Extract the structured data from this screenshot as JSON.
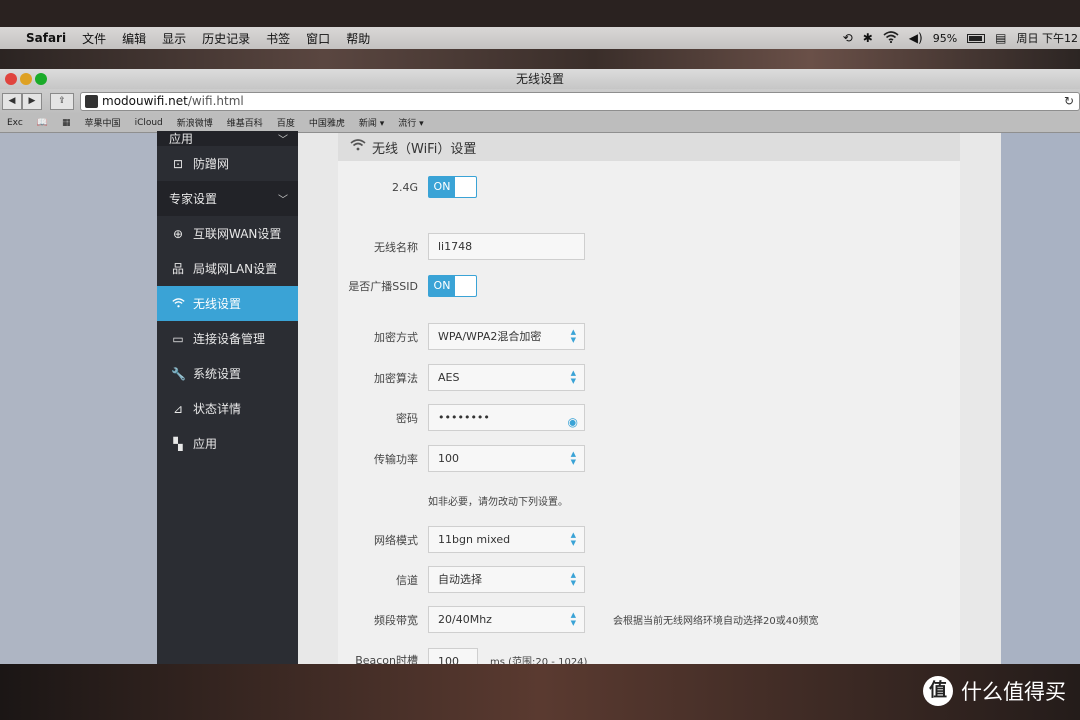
{
  "menubar": {
    "apple": "",
    "items": [
      "Safari",
      "文件",
      "编辑",
      "显示",
      "历史记录",
      "书签",
      "窗口",
      "帮助"
    ],
    "battery_percent": 95,
    "battery_label": "95%",
    "clock": "周日 下午12"
  },
  "browser": {
    "window_title": "无线设置",
    "url_domain": "modouwifi.net",
    "url_path": "/wifi.html",
    "bookmarks": [
      "Exc",
      "苹果中国",
      "iCloud",
      "新浪微博",
      "维基百科",
      "百度",
      "中国雅虎",
      "新闻 ▾",
      "流行 ▾"
    ]
  },
  "sidebar": {
    "items": [
      {
        "label": "应用",
        "icon": "apps-icon",
        "group": true
      },
      {
        "label": "防蹭网",
        "icon": "lock-icon"
      },
      {
        "label": "专家设置",
        "icon": "",
        "group": true
      },
      {
        "label": "互联网WAN设置",
        "icon": "globe-icon"
      },
      {
        "label": "局域网LAN设置",
        "icon": "network-icon"
      },
      {
        "label": "无线设置",
        "icon": "wifi-icon",
        "active": true
      },
      {
        "label": "连接设备管理",
        "icon": "monitor-icon"
      },
      {
        "label": "系统设置",
        "icon": "wrench-icon"
      },
      {
        "label": "状态详情",
        "icon": "chart-icon"
      },
      {
        "label": "应用",
        "icon": "apps-icon"
      }
    ]
  },
  "wifi": {
    "header": "无线（WiFi）设置",
    "band_label": "2.4G",
    "band_toggle": "ON",
    "ssid_label": "无线名称",
    "ssid_value": "li1748",
    "broadcast_label": "是否广播SSID",
    "broadcast_toggle": "ON",
    "encryption_label": "加密方式",
    "encryption_value": "WPA/WPA2混合加密",
    "algorithm_label": "加密算法",
    "algorithm_value": "AES",
    "password_label": "密码",
    "password_value": "••••••••",
    "power_label": "传输功率",
    "power_value": "100",
    "warning": "如非必要，请勿改动下列设置。",
    "mode_label": "网络模式",
    "mode_value": "11bgn mixed",
    "channel_label": "信道",
    "channel_value": "自动选择",
    "bandwidth_label": "频段带宽",
    "bandwidth_value": "20/40Mhz",
    "bandwidth_note": "会根据当前无线网络环境自动选择20或40频宽",
    "beacon_label": "Beacon时槽",
    "beacon_value": "100",
    "beacon_range": "ms (范围:20 - 1024)"
  },
  "watermark": {
    "badge": "值",
    "text": "什么值得买"
  }
}
